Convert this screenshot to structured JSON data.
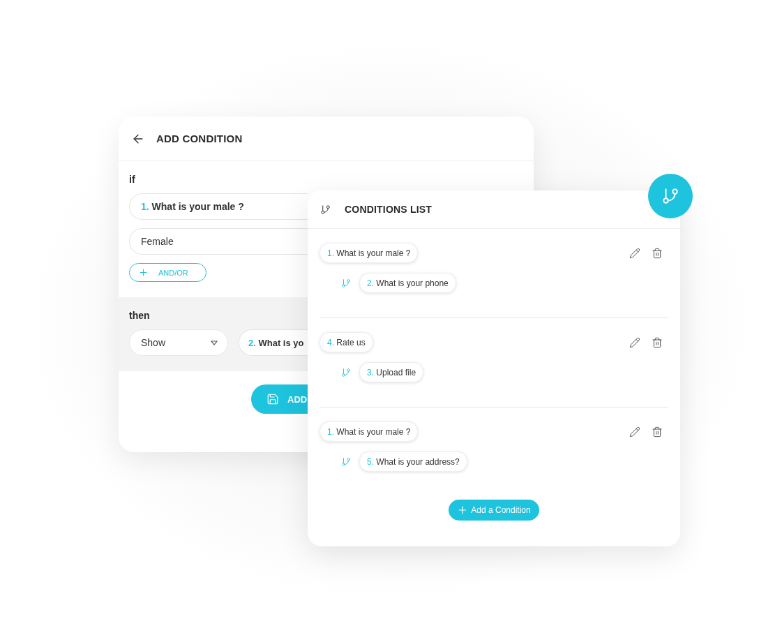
{
  "add_condition": {
    "title": "ADD CONDITION",
    "if_label": "if",
    "question": {
      "number": "1.",
      "text": "What is your male ?"
    },
    "answer": "Female",
    "and_or_button": "AND/OR",
    "then_label": "then",
    "action_select": "Show",
    "target_question": {
      "number": "2.",
      "text": "What is yo"
    },
    "save_button": "ADD"
  },
  "conditions_list": {
    "title": "CONDITIONS LIST",
    "conditions": [
      {
        "question": {
          "number": "1.",
          "text": "What is your male ?"
        },
        "target": {
          "number": "2.",
          "text": "What is your phone"
        }
      },
      {
        "question": {
          "number": "4.",
          "text": "Rate us"
        },
        "target": {
          "number": "3.",
          "text": "Upload file"
        }
      },
      {
        "question": {
          "number": "1.",
          "text": "What is your male ?"
        },
        "target": {
          "number": "5.",
          "text": "What is your address?"
        }
      }
    ],
    "add_button": "Add a Condition"
  }
}
